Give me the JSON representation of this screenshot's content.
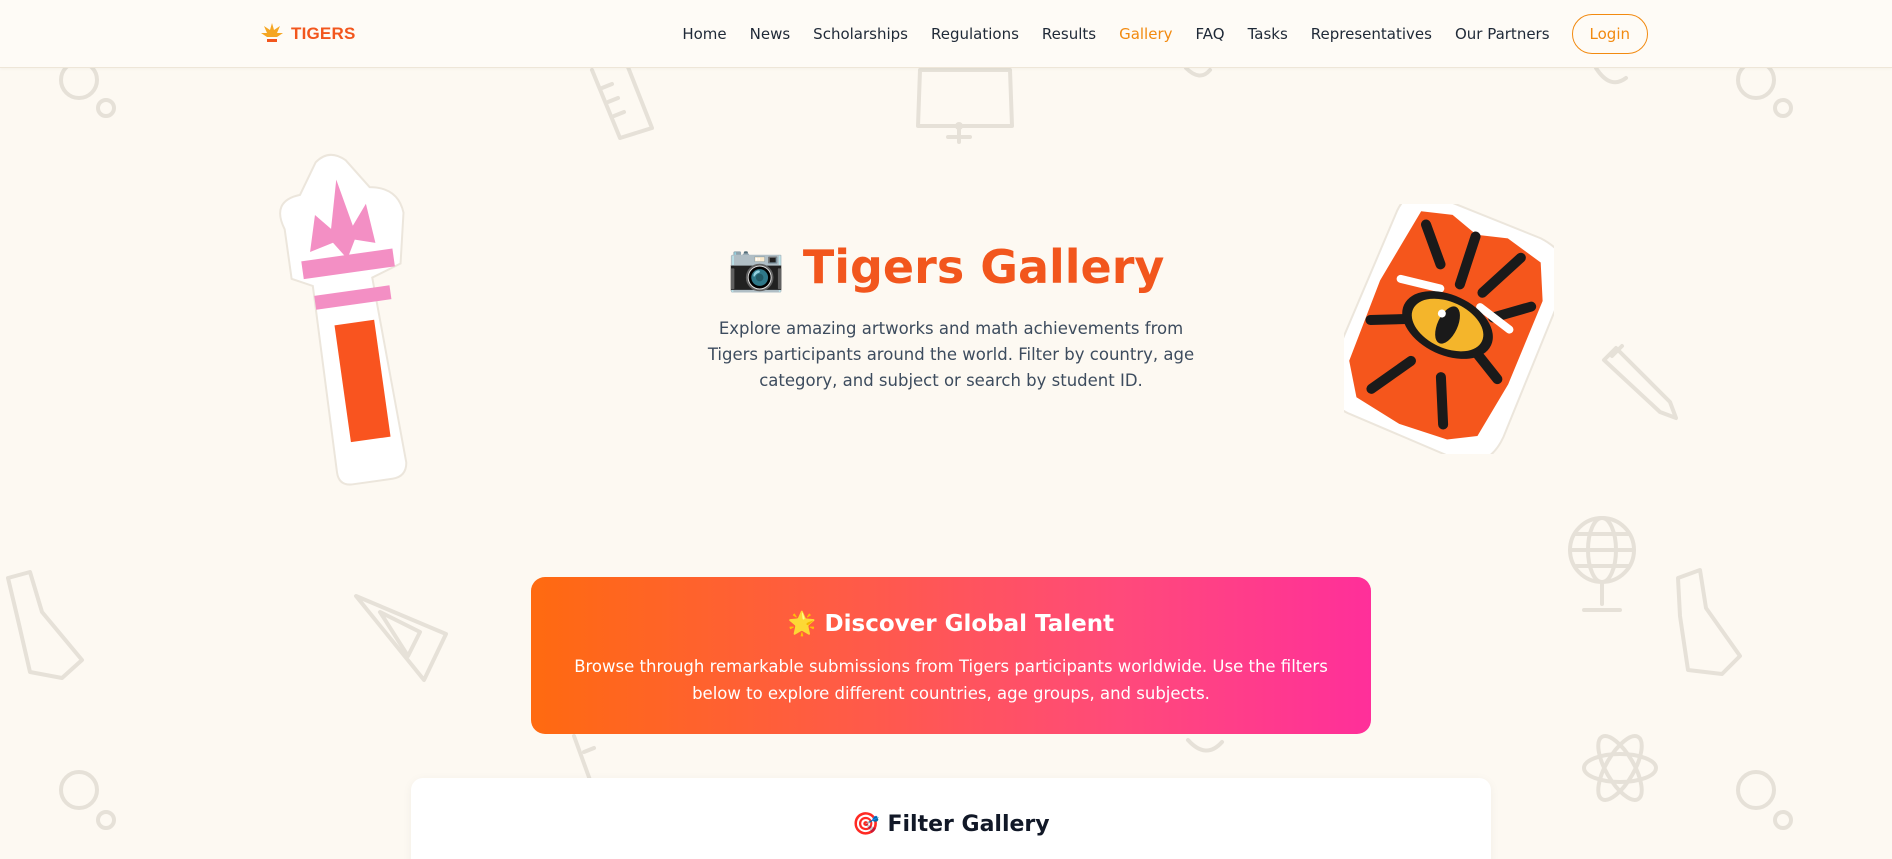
{
  "header": {
    "logo_text": "TIGERS",
    "nav": [
      {
        "label": "Home",
        "active": false
      },
      {
        "label": "News",
        "active": false
      },
      {
        "label": "Scholarships",
        "active": false
      },
      {
        "label": "Regulations",
        "active": false
      },
      {
        "label": "Results",
        "active": false
      },
      {
        "label": "Gallery",
        "active": true
      },
      {
        "label": "FAQ",
        "active": false
      },
      {
        "label": "Tasks",
        "active": false
      },
      {
        "label": "Representatives",
        "active": false
      },
      {
        "label": "Our Partners",
        "active": false
      }
    ],
    "login_label": "Login"
  },
  "hero": {
    "icon": "camera-icon",
    "icon_glyph": "📷",
    "title": "Tigers Gallery",
    "description": "Explore amazing artworks and math achievements from Tigers participants around the world. Filter by country, age category, and subject or search by student ID."
  },
  "banner": {
    "icon": "sparkle-sun-icon",
    "icon_glyph": "🌟",
    "title": "Discover Global Talent",
    "description": "Browse through remarkable submissions from Tigers participants worldwide. Use the filters below to explore different countries, age groups, and subjects."
  },
  "filter": {
    "icon": "target-icon",
    "icon_glyph": "🎯",
    "title": "Filter Gallery"
  },
  "colors": {
    "brand_orange": "#f2561d",
    "nav_active": "#f28a10",
    "page_bg": "#fdf9f2",
    "banner_gradient_start": "#ff6a10",
    "banner_gradient_end": "#ff2f9a"
  }
}
